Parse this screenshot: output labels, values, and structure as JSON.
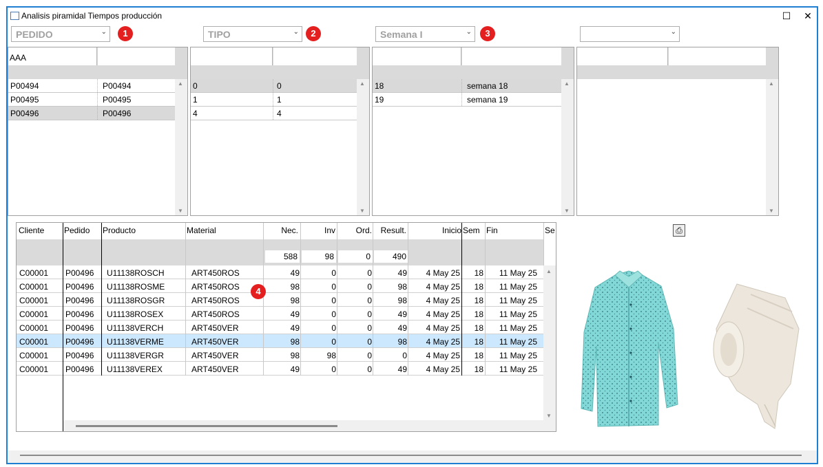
{
  "window": {
    "title": "Analisis piramidal  Tiempos producción",
    "maximize_icon": "☐",
    "close_icon": "✕"
  },
  "filters": [
    {
      "value": "PEDIDO",
      "badge": "1"
    },
    {
      "value": "TIPO",
      "badge": "2"
    },
    {
      "value": "Semana I",
      "badge": "3"
    },
    {
      "value": "",
      "badge": ""
    }
  ],
  "panels": {
    "pedido": {
      "header_label": "AAA",
      "rows": [
        {
          "a": "P00494",
          "b": "P00494"
        },
        {
          "a": "P00495",
          "b": "P00495"
        },
        {
          "a": "P00496",
          "b": "P00496"
        }
      ]
    },
    "tipo": {
      "rows": [
        {
          "a": "0",
          "b": "0"
        },
        {
          "a": "1",
          "b": "1"
        },
        {
          "a": "4",
          "b": "4"
        }
      ]
    },
    "semana": {
      "rows": [
        {
          "a": "18",
          "b": "semana 18"
        },
        {
          "a": "19",
          "b": "semana 19"
        }
      ]
    }
  },
  "grid": {
    "columns": [
      "Cliente",
      "Pedido",
      "Producto",
      "Material",
      "Nec.",
      "Inv",
      "Ord.",
      "Result.",
      "Inicio",
      "Sem",
      "Fin",
      "Se"
    ],
    "totals": {
      "nec": "588",
      "inv": "98",
      "ord": "0",
      "result": "490"
    },
    "badge": "4",
    "rows": [
      [
        "C00001",
        "P00496",
        "U11138ROSCH",
        "ART450ROS",
        "49",
        "0",
        "0",
        "49",
        "4 May 25",
        "18",
        "11 May 25"
      ],
      [
        "C00001",
        "P00496",
        "U11138ROSME",
        "ART450ROS",
        "98",
        "0",
        "0",
        "98",
        "4 May 25",
        "18",
        "11 May 25"
      ],
      [
        "C00001",
        "P00496",
        "U11138ROSGR",
        "ART450ROS",
        "98",
        "0",
        "0",
        "98",
        "4 May 25",
        "18",
        "11 May 25"
      ],
      [
        "C00001",
        "P00496",
        "U11138ROSEX",
        "ART450ROS",
        "49",
        "0",
        "0",
        "49",
        "4 May 25",
        "18",
        "11 May 25"
      ],
      [
        "C00001",
        "P00496",
        "U11138VERCH",
        "ART450VER",
        "49",
        "0",
        "0",
        "49",
        "4 May 25",
        "18",
        "11 May 25"
      ],
      [
        "C00001",
        "P00496",
        "U11138VERME",
        "ART450VER",
        "98",
        "0",
        "0",
        "98",
        "4 May 25",
        "18",
        "11 May 25"
      ],
      [
        "C00001",
        "P00496",
        "U11138VERGR",
        "ART450VER",
        "98",
        "98",
        "0",
        "0",
        "4 May 25",
        "18",
        "11 May 25"
      ],
      [
        "C00001",
        "P00496",
        "U11138VEREX",
        "ART450VER",
        "49",
        "0",
        "0",
        "49",
        "4 May 25",
        "18",
        "11 May 25"
      ]
    ]
  },
  "colors": {
    "badge": "#e41f1f",
    "window_border": "#1e7fd2",
    "row_selected": "#cce8ff",
    "shirt": "#7fd6d6",
    "fabric": "#ece6dc"
  }
}
